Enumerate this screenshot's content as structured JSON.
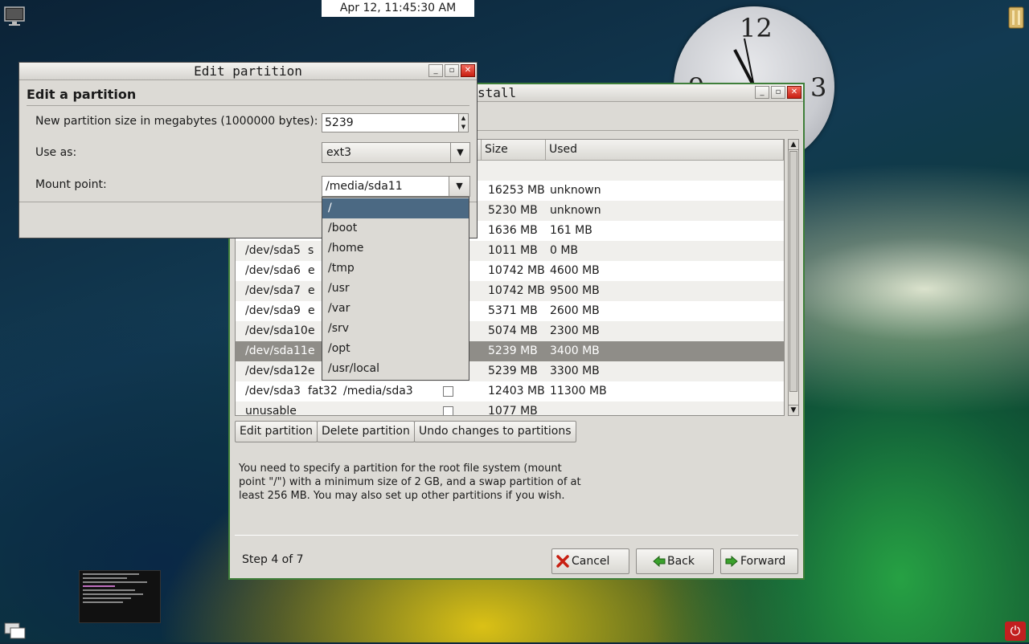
{
  "clock_text": "Apr 12, 11:45:30 AM",
  "analog_clock": {
    "numerals": [
      "12",
      "9",
      "3"
    ]
  },
  "main_window": {
    "title_visible": "stall",
    "table": {
      "headers": [
        "Size",
        "Used"
      ],
      "rows": [
        {
          "device": "",
          "type": "",
          "mount": "",
          "format": false,
          "size": "",
          "used": ""
        },
        {
          "device": "",
          "type": "",
          "mount": "",
          "format": false,
          "size": "16253 MB",
          "used": "unknown"
        },
        {
          "device": "",
          "type": "",
          "mount": "",
          "format": false,
          "size": "5230 MB",
          "used": "unknown"
        },
        {
          "device": "",
          "type": "",
          "mount": "",
          "format": false,
          "size": "1636 MB",
          "used": "161 MB"
        },
        {
          "device": "/dev/sda5",
          "type": "s",
          "mount": "",
          "format": false,
          "size": "1011 MB",
          "used": "0 MB"
        },
        {
          "device": "/dev/sda6",
          "type": "e",
          "mount": "",
          "format": false,
          "size": "10742 MB",
          "used": "4600 MB"
        },
        {
          "device": "/dev/sda7",
          "type": "e",
          "mount": "",
          "format": false,
          "size": "10742 MB",
          "used": "9500 MB"
        },
        {
          "device": "/dev/sda9",
          "type": "e",
          "mount": "",
          "format": false,
          "size": "5371 MB",
          "used": "2600 MB"
        },
        {
          "device": "/dev/sda10",
          "type": "e",
          "mount": "",
          "format": false,
          "size": "5074 MB",
          "used": "2300 MB"
        },
        {
          "device": "/dev/sda11",
          "type": "e",
          "mount": "",
          "format": false,
          "size": "5239 MB",
          "used": "3400 MB",
          "selected": true
        },
        {
          "device": "/dev/sda12",
          "type": "e",
          "mount": "",
          "format": false,
          "size": "5239 MB",
          "used": "3300 MB"
        },
        {
          "device": "/dev/sda3",
          "type": "fat32",
          "mount": "/media/sda3",
          "format": true,
          "size": "12403 MB",
          "used": "11300 MB"
        },
        {
          "device": "unusable",
          "type": "",
          "mount": "",
          "format": true,
          "size": "1077 MB",
          "used": ""
        }
      ]
    },
    "buttons": {
      "edit_partition": "Edit partition",
      "delete_partition": "Delete partition",
      "undo_changes": "Undo changes to partitions"
    },
    "info_text": "You need to specify a partition for the root file system (mount point \"/\") with a minimum size of 2 GB, and a swap partition of at least 256 MB. You may also set up other partitions if you wish.",
    "step_text": "Step 4 of 7",
    "nav": {
      "cancel": "Cancel",
      "back": "Back",
      "forward": "Forward"
    }
  },
  "edit_dialog": {
    "title": "Edit partition",
    "heading": "Edit a partition",
    "size_label": "New partition size in megabytes (1000000 bytes):",
    "size_value": "5239",
    "use_as_label": "Use as:",
    "use_as_value": "ext3",
    "mount_label": "Mount point:",
    "mount_value": "/media/sda11"
  },
  "mount_dropdown": {
    "options": [
      "/",
      "/boot",
      "/home",
      "/tmp",
      "/usr",
      "/var",
      "/srv",
      "/opt",
      "/usr/local"
    ],
    "highlighted_index": 0
  },
  "colors": {
    "accent": "#4b6983",
    "window_border": "#3f7f3a",
    "selected_row": "#8f8d88"
  }
}
